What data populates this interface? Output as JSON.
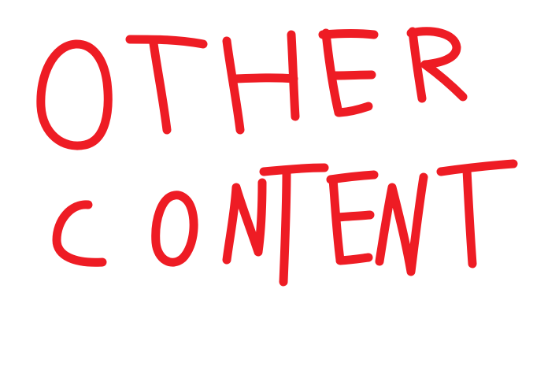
{
  "drawing": {
    "line1": "OTHER",
    "line2": "CONTENT",
    "ink_color": "#ee1c24",
    "background_color": "#ffffff"
  }
}
